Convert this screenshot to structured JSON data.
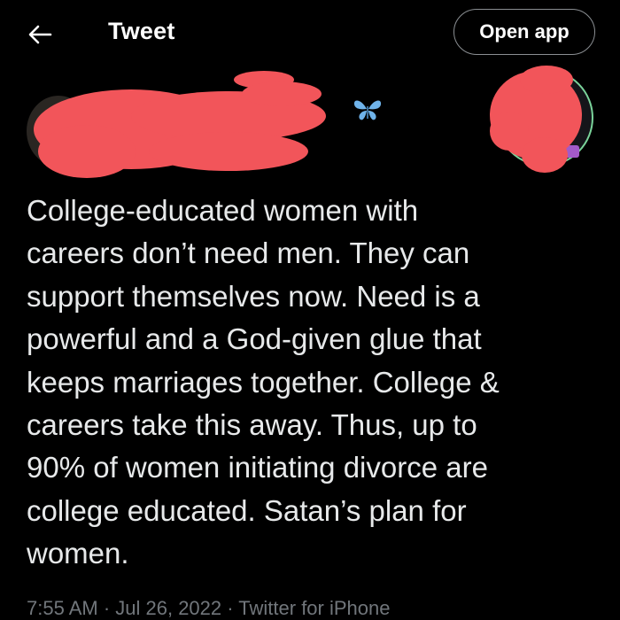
{
  "topbar": {
    "back_icon": "arrow-left-icon",
    "title": "Tweet",
    "open_app_label": "Open app"
  },
  "author": {
    "emoji_icon": "butterfly-icon",
    "name_redacted": true,
    "avatar_redacted": true
  },
  "tweet": {
    "lines": [
      "College-educated women with",
      "careers don’t need men. They can",
      "support themselves now. Need is a",
      "powerful and a God-given glue that",
      "keeps marriages together. College &",
      "careers take this away. Thus, up to",
      "90% of women initiating divorce are",
      "college educated. Satan’s plan for",
      "women."
    ],
    "text": "College-educated women with\ncareers don’t need men. They can\nsupport themselves now. Need is a\npowerful and a God-given glue that\nkeeps marriages together. College &\ncareers take this away. Thus, up to\n90% of women initiating divorce are\ncollege educated. Satan’s plan for\nwomen.",
    "time": "7:55 AM",
    "date": "Jul 26, 2022",
    "source": "Twitter for iPhone",
    "meta_line": "7:55 AM · Jul 26, 2022 · Twitter for iPhone"
  },
  "colors": {
    "background": "#000000",
    "text": "#e7e9ea",
    "muted": "#71767b",
    "redaction": "#f2555a",
    "butterfly": "#6fb3ea"
  }
}
